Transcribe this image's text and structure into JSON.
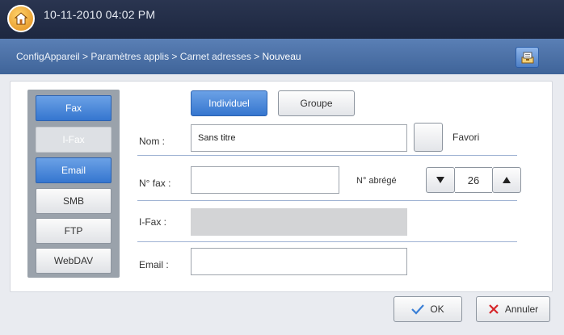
{
  "header": {
    "datetime": "10-11-2010 04:02 PM"
  },
  "breadcrumb": {
    "path": "ConfigAppareil > Paramètres applis > Carnet adresses > ",
    "current": "Nouveau"
  },
  "sidebar": {
    "items": [
      {
        "label": "Fax",
        "state": "selected"
      },
      {
        "label": "I-Fax",
        "state": "disabled"
      },
      {
        "label": "Email",
        "state": "selected"
      },
      {
        "label": "SMB",
        "state": "normal"
      },
      {
        "label": "FTP",
        "state": "normal"
      },
      {
        "label": "WebDAV",
        "state": "normal"
      }
    ]
  },
  "tabs": {
    "individual": "Individuel",
    "group": "Groupe"
  },
  "form": {
    "name_label": "Nom :",
    "name_value": "Sans titre",
    "favorite_label": "Favori",
    "fax_label": "N° fax :",
    "fax_value": "",
    "speed_dial_label": "N° abrégé",
    "speed_dial_value": "26",
    "ifax_label": "I-Fax :",
    "ifax_value": "",
    "email_label": "Email :",
    "email_value": ""
  },
  "actions": {
    "ok_label": "OK",
    "cancel_label": "Annuler"
  },
  "colors": {
    "accent_blue": "#3576cf",
    "topbar": "#1d2740",
    "breadcrumb_bar": "#4a70a8",
    "ok_check": "#3a7fd6",
    "cancel_x": "#d6262a"
  }
}
